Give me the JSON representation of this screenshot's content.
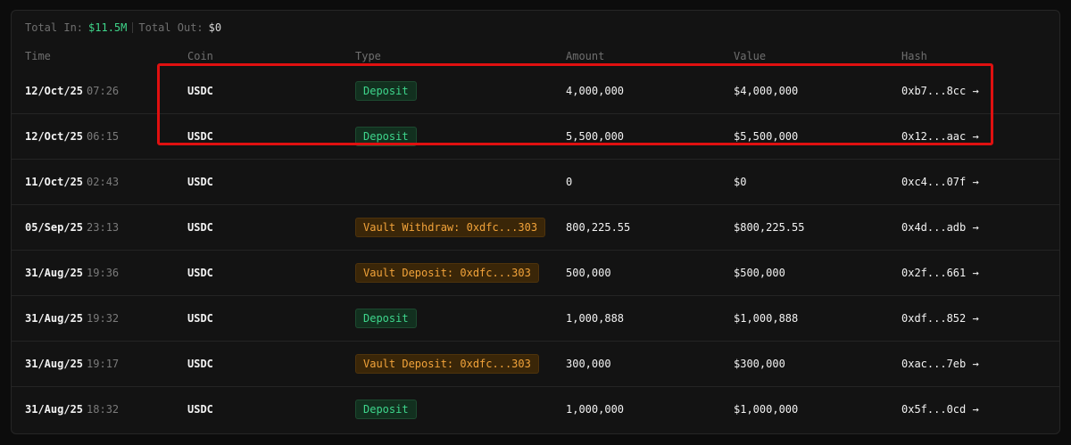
{
  "summary": {
    "total_in_label": "Total In:",
    "total_in_value": "$11.5M",
    "total_out_label": "Total Out:",
    "total_out_value": "$0"
  },
  "columns": [
    "Time",
    "Coin",
    "Type",
    "Amount",
    "Value",
    "Hash"
  ],
  "rows": [
    {
      "date": "12/Oct/25",
      "time": "07:26",
      "coin": "USDC",
      "type": "Deposit",
      "type_style": "green",
      "amount": "4,000,000",
      "value": "$4,000,000",
      "hash": "0xb7...8cc →"
    },
    {
      "date": "12/Oct/25",
      "time": "06:15",
      "coin": "USDC",
      "type": "Deposit",
      "type_style": "green",
      "amount": "5,500,000",
      "value": "$5,500,000",
      "hash": "0x12...aac →"
    },
    {
      "date": "11/Oct/25",
      "time": "02:43",
      "coin": "USDC",
      "type": "",
      "type_style": "",
      "amount": "0",
      "value": "$0",
      "hash": "0xc4...07f →"
    },
    {
      "date": "05/Sep/25",
      "time": "23:13",
      "coin": "USDC",
      "type": "Vault Withdraw: 0xdfc...303",
      "type_style": "orange",
      "amount": "800,225.55",
      "value": "$800,225.55",
      "hash": "0x4d...adb →"
    },
    {
      "date": "31/Aug/25",
      "time": "19:36",
      "coin": "USDC",
      "type": "Vault Deposit: 0xdfc...303",
      "type_style": "orange",
      "amount": "500,000",
      "value": "$500,000",
      "hash": "0x2f...661 →"
    },
    {
      "date": "31/Aug/25",
      "time": "19:32",
      "coin": "USDC",
      "type": "Deposit",
      "type_style": "green",
      "amount": "1,000,888",
      "value": "$1,000,888",
      "hash": "0xdf...852 →"
    },
    {
      "date": "31/Aug/25",
      "time": "19:17",
      "coin": "USDC",
      "type": "Vault Deposit: 0xdfc...303",
      "type_style": "orange",
      "amount": "300,000",
      "value": "$300,000",
      "hash": "0xac...7eb →"
    },
    {
      "date": "31/Aug/25",
      "time": "18:32",
      "coin": "USDC",
      "type": "Deposit",
      "type_style": "green",
      "amount": "1,000,000",
      "value": "$1,000,000",
      "hash": "0x5f...0cd →"
    }
  ],
  "colors": {
    "accent_green": "#3ed68c",
    "accent_orange": "#f2a33a",
    "highlight_red": "#e01010"
  }
}
